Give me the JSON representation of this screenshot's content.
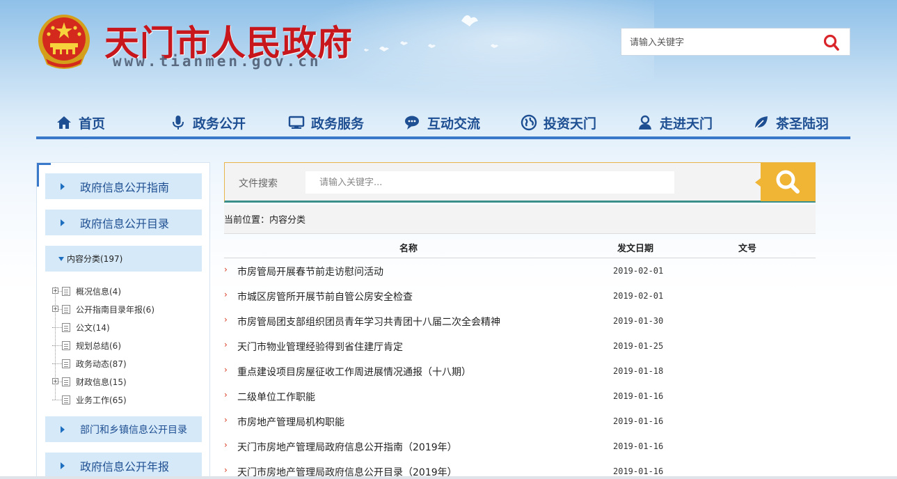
{
  "header": {
    "site_title": "天门市人民政府",
    "site_url": "www.tianmen.gov.cn",
    "search": {
      "placeholder": "请输入关键字"
    }
  },
  "nav": {
    "items": [
      {
        "label": "首页",
        "icon": "home-icon"
      },
      {
        "label": "政务公开",
        "icon": "microphone-icon"
      },
      {
        "label": "政务服务",
        "icon": "monitor-icon"
      },
      {
        "label": "互动交流",
        "icon": "chat-icon"
      },
      {
        "label": "投资天门",
        "icon": "globe-icon"
      },
      {
        "label": "走进天门",
        "icon": "person-icon"
      },
      {
        "label": "茶圣陆羽",
        "icon": "leaf-icon"
      }
    ]
  },
  "sidebar": {
    "buttons": [
      {
        "label": "政府信息公开指南"
      },
      {
        "label": "政府信息公开目录"
      }
    ],
    "tree_root": {
      "label": "内容分类(197)"
    },
    "tree_nodes": [
      {
        "label": "概况信息(4)",
        "expandable": true
      },
      {
        "label": "公开指南目录年报(6)",
        "expandable": true
      },
      {
        "label": "公文(14)",
        "expandable": false
      },
      {
        "label": "规划总结(6)",
        "expandable": false
      },
      {
        "label": "政务动态(87)",
        "expandable": false
      },
      {
        "label": "财政信息(15)",
        "expandable": true
      },
      {
        "label": "业务工作(65)",
        "expandable": false
      }
    ],
    "bottom_buttons": [
      {
        "label": "部门和乡镇信息公开目录"
      },
      {
        "label": "政府信息公开年报"
      }
    ]
  },
  "file_search": {
    "label": "文件搜索",
    "placeholder": "请输入关键字..."
  },
  "breadcrumb": {
    "text": "当前位置：内容分类"
  },
  "table": {
    "columns": {
      "name": "名称",
      "date": "发文日期",
      "doc_no": "文号"
    },
    "rows": [
      {
        "title": "市房管局开展春节前走访慰问活动",
        "date": "2019-02-01"
      },
      {
        "title": "市城区房管所开展节前自管公房安全检查",
        "date": "2019-02-01"
      },
      {
        "title": "市房管局团支部组织团员青年学习共青团十八届二次全会精神",
        "date": "2019-01-30"
      },
      {
        "title": "天门市物业管理经验得到省住建厅肯定",
        "date": "2019-01-25"
      },
      {
        "title": "重点建设项目房屋征收工作周进展情况通报（十八期）",
        "date": "2019-01-18"
      },
      {
        "title": "二级单位工作职能",
        "date": "2019-01-16"
      },
      {
        "title": "市房地产管理局机构职能",
        "date": "2019-01-16"
      },
      {
        "title": "天门市房地产管理局政府信息公开指南（2019年）",
        "date": "2019-01-16"
      },
      {
        "title": "天门市房地产管理局政府信息公开目录（2019年）",
        "date": "2019-01-16"
      }
    ]
  },
  "colors": {
    "brand_red": "#c8161d",
    "nav_blue": "#1e4f92",
    "accent_blue": "#3a78c9",
    "search_yellow": "#f0b535"
  }
}
